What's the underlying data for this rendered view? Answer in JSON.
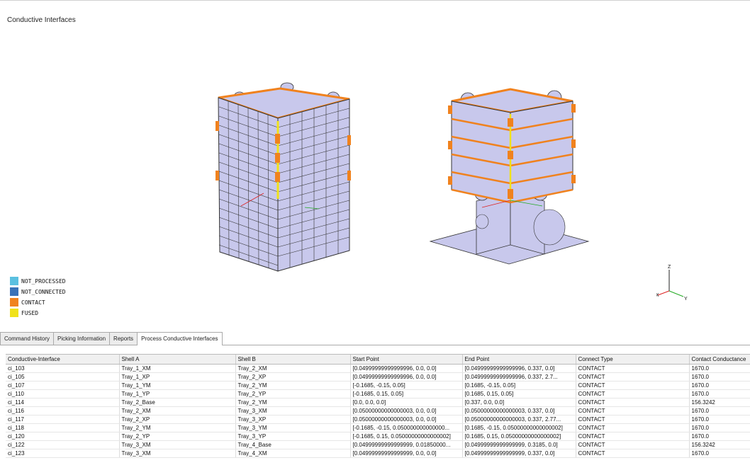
{
  "viewport": {
    "title": "Conductive Interfaces",
    "legend": [
      {
        "label": "NOT_PROCESSED",
        "color": "#5bc0e0"
      },
      {
        "label": "NOT_CONNECTED",
        "color": "#3a72b8"
      },
      {
        "label": "CONTACT",
        "color": "#f0821e"
      },
      {
        "label": "FUSED",
        "color": "#f0e21a"
      }
    ],
    "triad": {
      "x": "X",
      "y": "Y",
      "z": "Z"
    },
    "colors": {
      "body": "#c8c8ec",
      "edge": "#333333",
      "contact": "#f0821e",
      "fused": "#f0e21a"
    }
  },
  "tabs": [
    {
      "label": "Command History",
      "active": false
    },
    {
      "label": "Picking Information",
      "active": false
    },
    {
      "label": "Reports",
      "active": false
    },
    {
      "label": "Process Conductive Interfaces",
      "active": true
    }
  ],
  "table": {
    "columns": [
      "Conductive-Interface",
      "Shell A",
      "Shell B",
      "Start Point",
      "End Point",
      "Connect Type",
      "Contact Conductance"
    ],
    "rows": [
      [
        "ci_103",
        "Tray_1_XM",
        "Tray_2_XM",
        "[0.04999999999999996, 0.0, 0.0]",
        "[0.04999999999999996, 0.337, 0.0]",
        "CONTACT",
        "1670.0"
      ],
      [
        "ci_105",
        "Tray_1_XP",
        "Tray_2_XP",
        "[0.04999999999999996, 0.0, 0.0]",
        "[0.04999999999999996, 0.337, 2.7...",
        "CONTACT",
        "1670.0"
      ],
      [
        "ci_107",
        "Tray_1_YM",
        "Tray_2_YM",
        "[-0.1685, -0.15, 0.05]",
        "[0.1685, -0.15, 0.05]",
        "CONTACT",
        "1670.0"
      ],
      [
        "ci_110",
        "Tray_1_YP",
        "Tray_2_YP",
        "[-0.1685, 0.15, 0.05]",
        "[0.1685, 0.15, 0.05]",
        "CONTACT",
        "1670.0"
      ],
      [
        "ci_114",
        "Tray_2_Base",
        "Tray_2_YM",
        "[0.0, 0.0, 0.0]",
        "[0.337, 0.0, 0.0]",
        "CONTACT",
        "156.3242"
      ],
      [
        "ci_116",
        "Tray_2_XM",
        "Tray_3_XM",
        "[0.05000000000000003, 0.0, 0.0]",
        "[0.05000000000000003, 0.337, 0.0]",
        "CONTACT",
        "1670.0"
      ],
      [
        "ci_117",
        "Tray_2_XP",
        "Tray_3_XP",
        "[0.05000000000000003, 0.0, 0.0]",
        "[0.05000000000000003, 0.337, 2.77...",
        "CONTACT",
        "1670.0"
      ],
      [
        "ci_118",
        "Tray_2_YM",
        "Tray_3_YM",
        "[-0.1685, -0.15, 0.050000000000000...",
        "[0.1685, -0.15, 0.05000000000000002]",
        "CONTACT",
        "1670.0"
      ],
      [
        "ci_120",
        "Tray_2_YP",
        "Tray_3_YP",
        "[-0.1685, 0.15, 0.05000000000000002]",
        "[0.1685, 0.15, 0.05000000000000002]",
        "CONTACT",
        "1670.0"
      ],
      [
        "ci_122",
        "Tray_3_XM",
        "Tray_4_Base",
        "[0.04999999999999999, 0.01850000...",
        "[0.04999999999999999, 0.3185, 0.0]",
        "CONTACT",
        "156.3242"
      ],
      [
        "ci_123",
        "Tray_3_XM",
        "Tray_4_XM",
        "[0.04999999999999999, 0.0, 0.0]",
        "[0.04999999999999999, 0.337, 0.0]",
        "CONTACT",
        "1670.0"
      ]
    ]
  }
}
